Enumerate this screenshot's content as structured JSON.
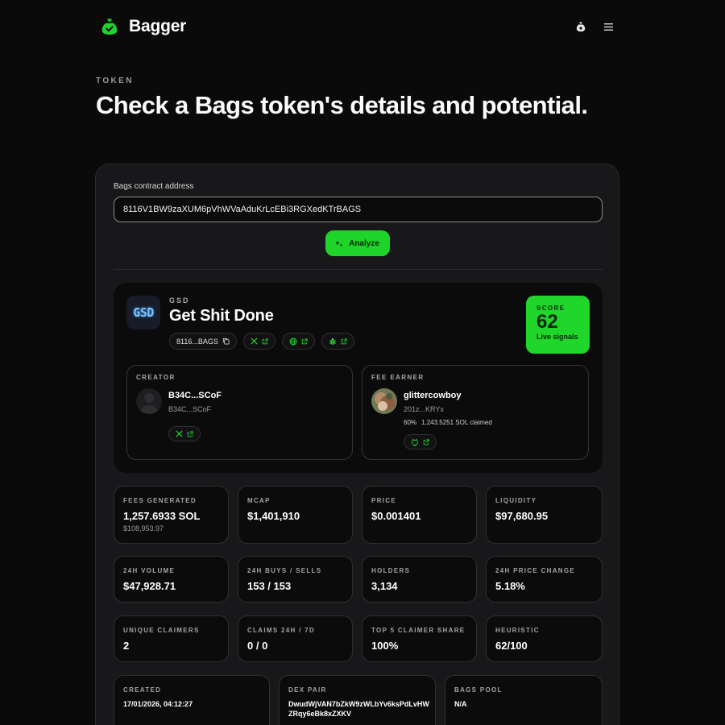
{
  "app": {
    "name": "Bagger"
  },
  "page": {
    "eyebrow": "TOKEN",
    "title": "Check a Bags token's details and potential."
  },
  "form": {
    "label": "Bags contract address",
    "value": "8116V1BW9zaXUM6pVhWVaAduKrLcEBi3RGXedKTrBAGS",
    "analyze_label": "Analyze"
  },
  "token": {
    "logo_text": "GSD",
    "symbol": "GSD",
    "name": "Get Shit Done",
    "short_address": "8116...BAGS",
    "score_label": "SCORE",
    "score_value": "62",
    "score_sub": "Live signals"
  },
  "creator": {
    "label": "CREATOR",
    "name": "B34C...SCoF",
    "handle": "B34C...SCoF"
  },
  "fee_earner": {
    "label": "FEE EARNER",
    "name": "glittercowboy",
    "handle": "201z...KRYx",
    "share": "60%",
    "claimed": "1,243.5251 SOL claimed"
  },
  "stats": [
    {
      "label": "FEES GENERATED",
      "value": "1,257.6933 SOL",
      "sub": "$108,953.97"
    },
    {
      "label": "MCAP",
      "value": "$1,401,910"
    },
    {
      "label": "PRICE",
      "value": "$0.001401"
    },
    {
      "label": "LIQUIDITY",
      "value": "$97,680.95"
    },
    {
      "label": "24H VOLUME",
      "value": "$47,928.71"
    },
    {
      "label": "24H BUYS / SELLS",
      "value": "153 / 153"
    },
    {
      "label": "HOLDERS",
      "value": "3,134"
    },
    {
      "label": "24H PRICE CHANGE",
      "value": "5.18%"
    },
    {
      "label": "UNIQUE CLAIMERS",
      "value": "2"
    },
    {
      "label": "CLAIMS 24H / 7D",
      "value": "0 / 0"
    },
    {
      "label": "TOP 5 CLAIMER SHARE",
      "value": "100%"
    },
    {
      "label": "HEURISTIC",
      "value": "62/100"
    }
  ],
  "details": [
    {
      "label": "CREATED",
      "value": "17/01/2026, 04:12:27"
    },
    {
      "label": "DEX PAIR",
      "value": "DwudWjVAN7bZkW9zWLbYv6ksPdLvHWZRqy6eBk8xZXKV"
    },
    {
      "label": "BAGS POOL",
      "value": "N/A"
    }
  ],
  "colors": {
    "accent": "#1ed428",
    "background": "#0a0a0a",
    "card": "#18181a"
  },
  "icons": [
    "bag-icon",
    "menu-icon",
    "copy-icon",
    "x-icon",
    "external-link-icon",
    "globe-icon",
    "bug-icon",
    "github-icon",
    "sparkle-icon"
  ]
}
